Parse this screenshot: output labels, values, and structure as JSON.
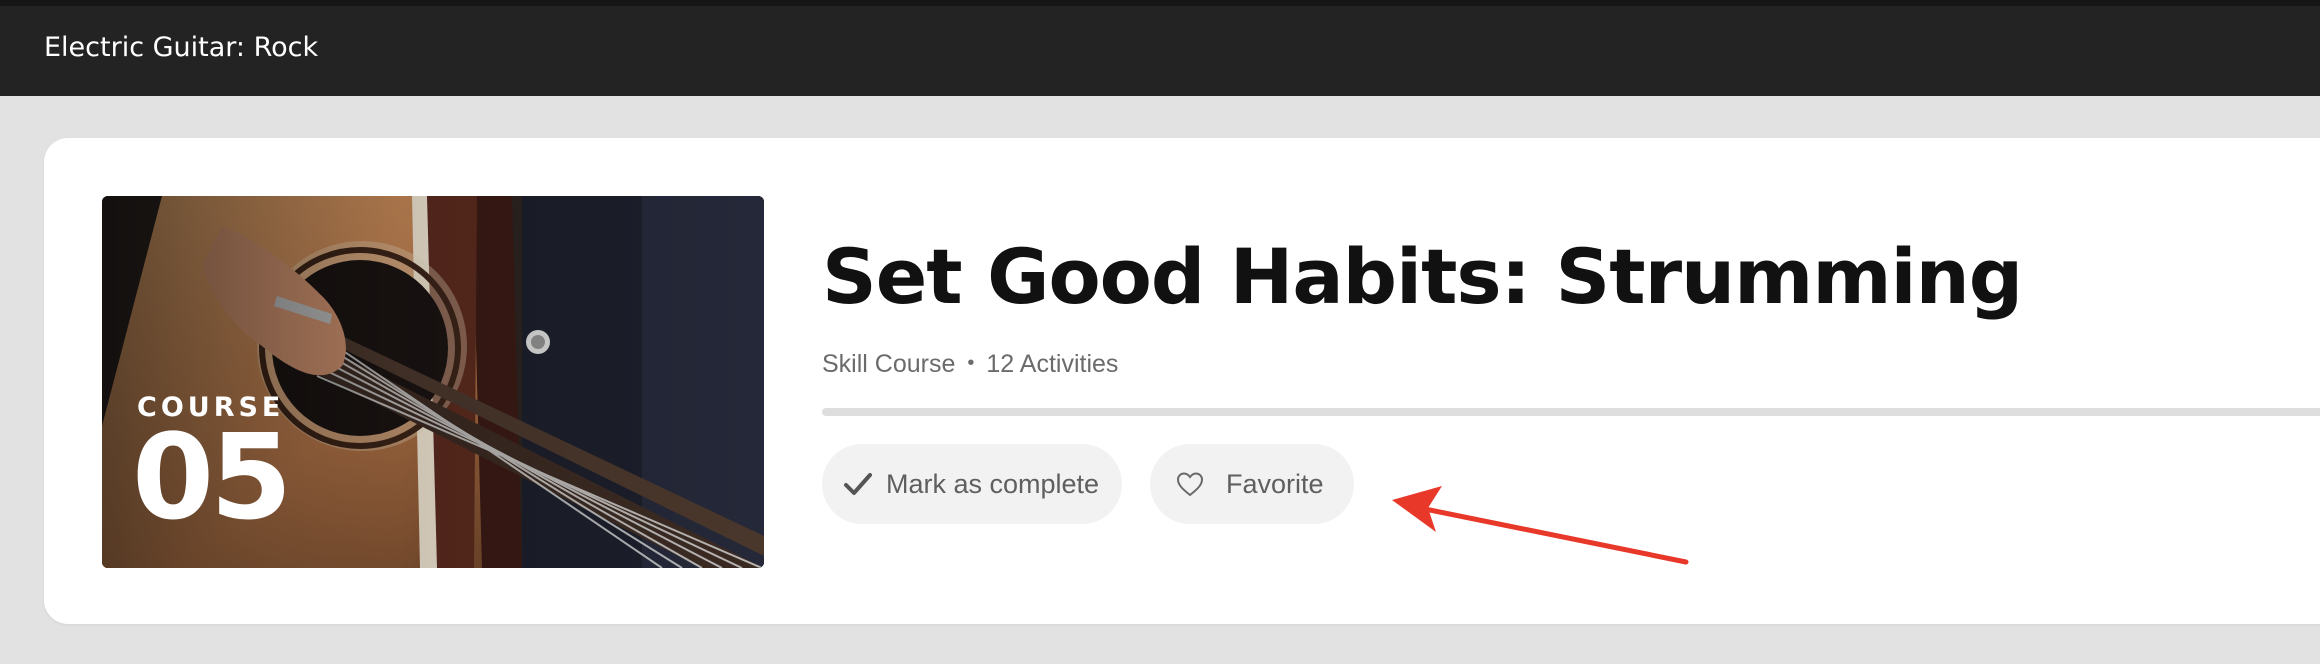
{
  "header": {
    "title": "Electric Guitar: Rock"
  },
  "course": {
    "thumbnail_label": "COURSE",
    "thumbnail_number": "05",
    "title": "Set Good Habits: Strumming",
    "type": "Skill Course",
    "separator": "•",
    "activities": "12 Activities",
    "progress": 0
  },
  "actions": {
    "complete": {
      "label": "Mark as complete",
      "icon": "checkmark-icon"
    },
    "favorite": {
      "label": "Favorite",
      "icon": "heart-outline-icon"
    }
  },
  "annotation": {
    "icon": "red-arrow-annotation",
    "color": "#e8382a"
  },
  "colors": {
    "topbar": "#232323",
    "background": "#e2e2e2",
    "card": "#ffffff",
    "pill": "#f2f2f2"
  }
}
